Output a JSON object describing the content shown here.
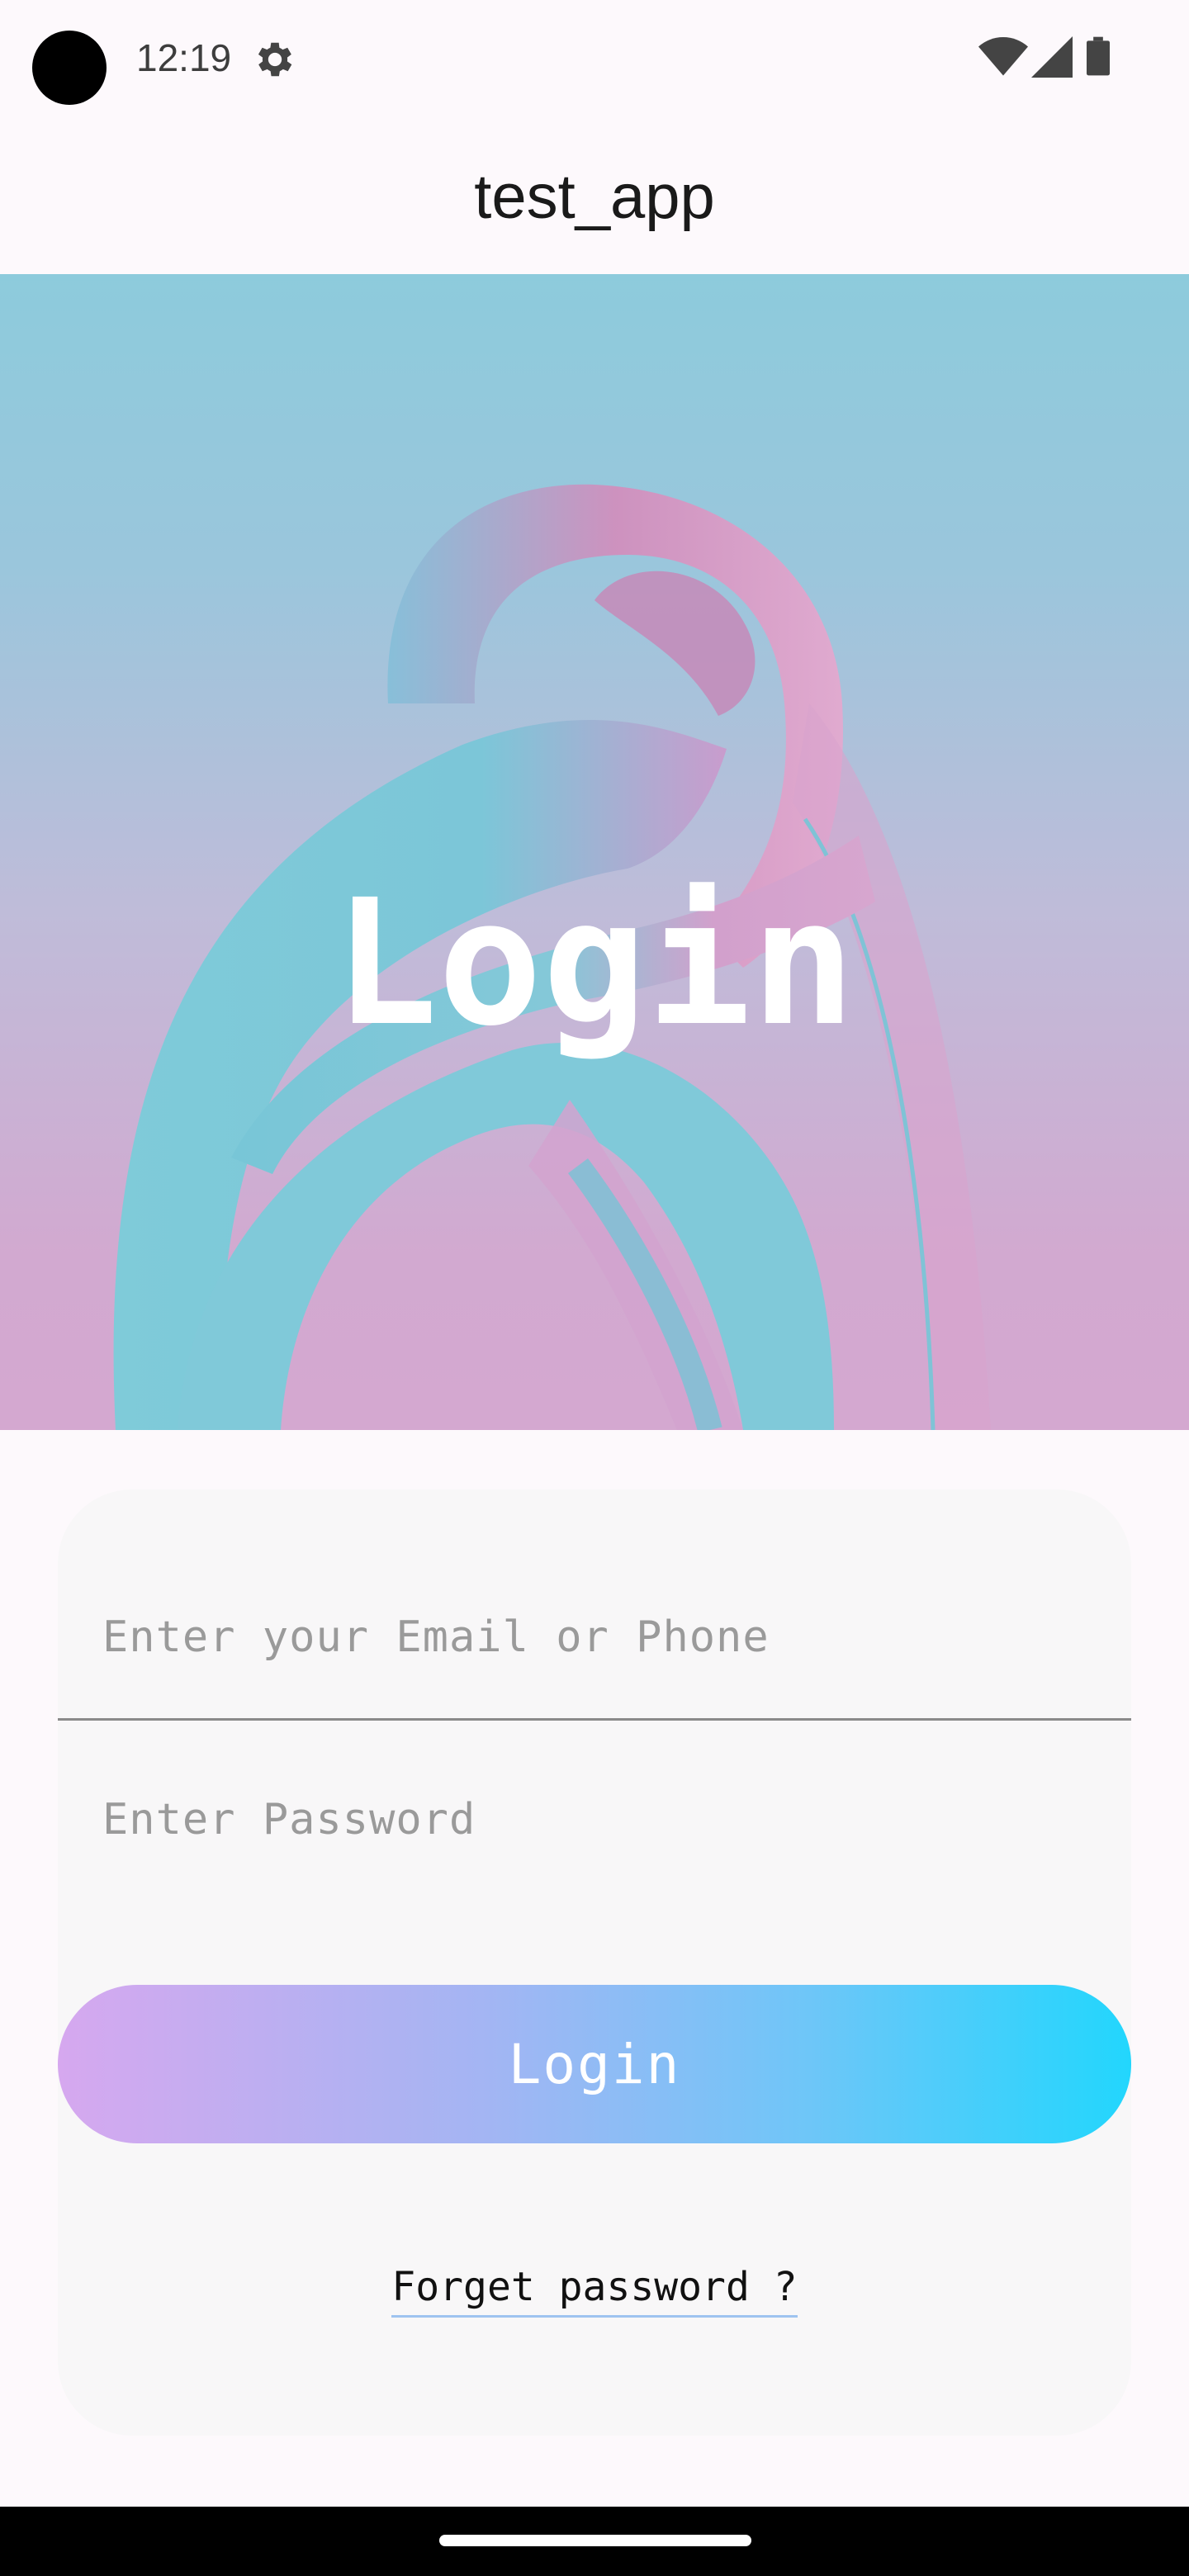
{
  "status_bar": {
    "time": "12:19",
    "icons": [
      "camera-dot",
      "gear-icon",
      "wifi-icon",
      "cell-signal-icon",
      "battery-icon"
    ]
  },
  "app_bar": {
    "title": "test_app"
  },
  "hero": {
    "title": "Login"
  },
  "form": {
    "email_placeholder": "Enter your Email or Phone",
    "email_value": "",
    "password_placeholder": "Enter Password",
    "password_value": "",
    "login_label": "Login",
    "forget_label": "Forget password ?"
  },
  "colors": {
    "button_gradient_start": "#d6a8ef",
    "button_gradient_end": "#22d6fd",
    "hero_top": "#8dcbdc",
    "hero_bottom": "#d4a8d0"
  }
}
